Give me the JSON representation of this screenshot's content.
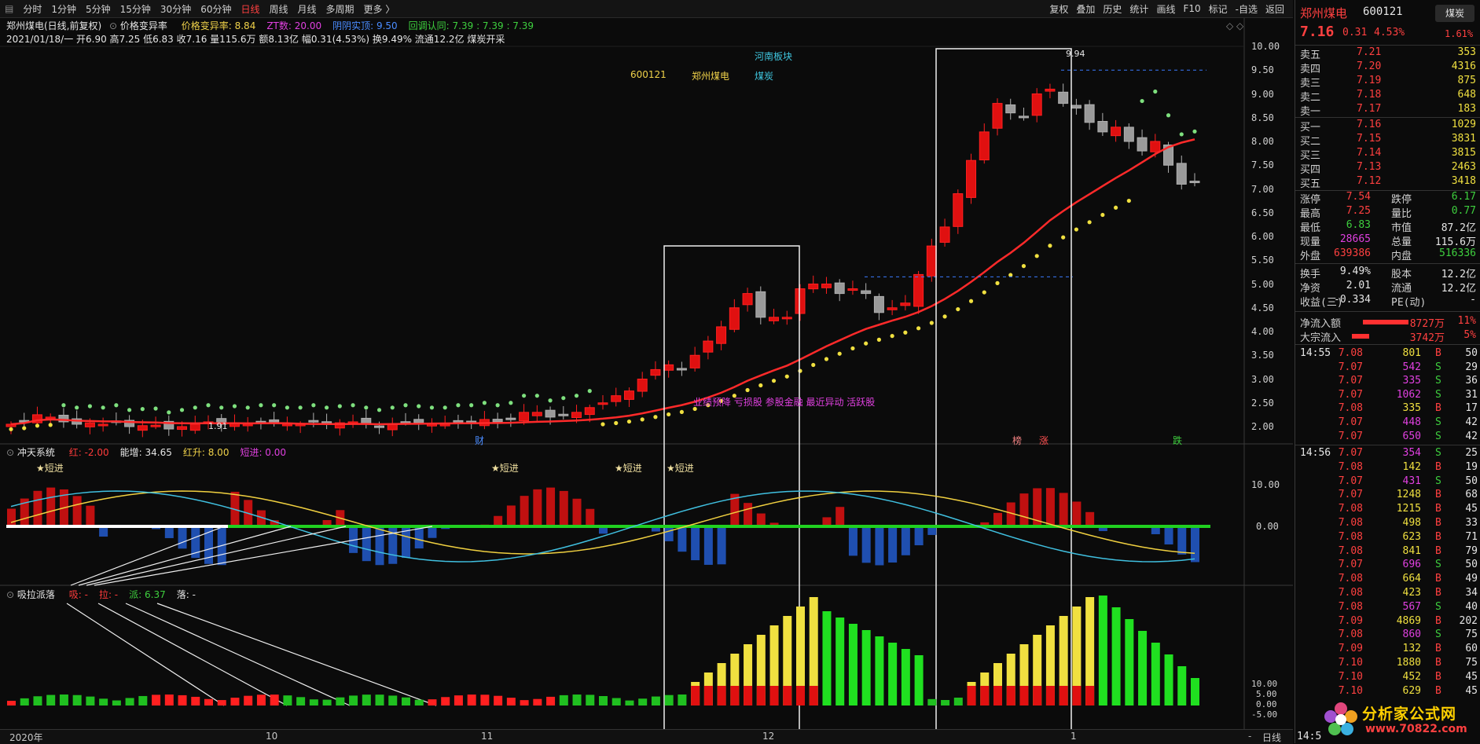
{
  "menu": {
    "periods": [
      "分时",
      "1分钟",
      "5分钟",
      "15分钟",
      "30分钟",
      "60分钟",
      "日线",
      "周线",
      "月线",
      "多周期",
      "更多 〉"
    ],
    "active_period": "日线",
    "right_tools": [
      "复权",
      "叠加",
      "历史",
      "统计",
      "画线",
      "F10",
      "标记",
      "-自选",
      "返回"
    ]
  },
  "header": {
    "title": "郑州煤电(日线,前复权)",
    "indicator": "价格变异率",
    "line1": [
      {
        "t": "价格变异率: 8.84",
        "c": "yel"
      },
      {
        "t": "ZT数: 20.00",
        "c": "mag"
      },
      {
        "t": "阴阴实顶: 9.50",
        "c": "blue"
      },
      {
        "t": "回调认同: 7.39 : 7.39 : 7.39",
        "c": "green"
      }
    ],
    "line2": "2021/01/18/一 开6.90 高7.25 低6.83 收7.16 量115.6万 额8.13亿 幅0.31(4.53%) 换9.49% 流通12.2亿 煤炭开采"
  },
  "overlay": {
    "sector": "河南板块",
    "code": "600121",
    "name": "郑州煤电",
    "industry": "煤炭",
    "tags": "业绩预降  亏损股  参股金融  最近异动  活跃股",
    "high_mark": "9.94",
    "low_mark": "1.91",
    "markers": [
      "财",
      "榜",
      "涨",
      "跌"
    ]
  },
  "price_axis": [
    "10.00",
    "9.50",
    "9.00",
    "8.50",
    "8.00",
    "7.50",
    "7.00",
    "6.50",
    "6.00",
    "5.50",
    "5.00",
    "4.50",
    "4.00",
    "3.50",
    "3.00",
    "2.50",
    "2.00"
  ],
  "panel2": {
    "name": "冲天系统",
    "values": [
      {
        "t": "红: -2.00",
        "c": "red"
      },
      {
        "t": "能增: 34.65",
        "c": "white"
      },
      {
        "t": "红升: 8.00",
        "c": "yel"
      },
      {
        "t": "短进: 0.00",
        "c": "mag"
      }
    ],
    "axis": [
      "10.00",
      "0.00"
    ],
    "signal": "★短进"
  },
  "panel3": {
    "name": "吸拉派落",
    "values": [
      {
        "t": "吸: -",
        "c": "red"
      },
      {
        "t": "拉: -",
        "c": "red"
      },
      {
        "t": "派: 6.37",
        "c": "green"
      },
      {
        "t": "落: -",
        "c": "white"
      }
    ],
    "axis": [
      "10.00",
      "5.00",
      "0.00",
      "-5.00"
    ]
  },
  "xaxis": {
    "labels": [
      "2020年",
      "10",
      "11",
      "12",
      "1"
    ],
    "period": "日线"
  },
  "quote": {
    "name": "郑州煤电",
    "code": "600121",
    "tag": "煤炭",
    "price": "7.16",
    "change": "0.31",
    "pct": "4.53%",
    "right_pct": "1.61%",
    "asks": [
      [
        "卖五",
        "7.21",
        "353"
      ],
      [
        "卖四",
        "7.20",
        "4316"
      ],
      [
        "卖三",
        "7.19",
        "875"
      ],
      [
        "卖二",
        "7.18",
        "648"
      ],
      [
        "卖一",
        "7.17",
        "183"
      ]
    ],
    "bids": [
      [
        "买一",
        "7.16",
        "1029"
      ],
      [
        "买二",
        "7.15",
        "3831"
      ],
      [
        "买三",
        "7.14",
        "3815"
      ],
      [
        "买四",
        "7.13",
        "2463"
      ],
      [
        "买五",
        "7.12",
        "3418"
      ]
    ],
    "stats": [
      [
        "涨停",
        "7.54",
        "跌停",
        "6.17"
      ],
      [
        "最高",
        "7.25",
        "量比",
        "0.77"
      ],
      [
        "最低",
        "6.83",
        "市值",
        "87.2亿"
      ],
      [
        "现量",
        "28665",
        "总量",
        "115.6万"
      ],
      [
        "外盘",
        "639386",
        "内盘",
        "516336"
      ]
    ],
    "stats2": [
      [
        "换手",
        "9.49%",
        "股本",
        "12.2亿"
      ],
      [
        "净资",
        "2.01",
        "流通",
        "12.2亿"
      ],
      [
        "收益(三)",
        "-0.334",
        "PE(动)",
        "-"
      ]
    ],
    "flows": [
      [
        "净流入额",
        "8727万",
        "11%"
      ],
      [
        "大宗流入",
        "3742万",
        "5%"
      ]
    ]
  },
  "ticks1455": [
    [
      "14:55",
      "7.08",
      "801",
      "B",
      "50"
    ],
    [
      "",
      "7.07",
      "542",
      "S",
      "29"
    ],
    [
      "",
      "7.07",
      "335",
      "S",
      "36"
    ],
    [
      "",
      "7.07",
      "1062",
      "S",
      "31"
    ],
    [
      "",
      "7.08",
      "335",
      "B",
      "17"
    ],
    [
      "",
      "7.07",
      "448",
      "S",
      "42"
    ],
    [
      "",
      "7.07",
      "650",
      "S",
      "42"
    ]
  ],
  "ticks1456": [
    [
      "14:56",
      "7.07",
      "354",
      "S",
      "25"
    ],
    [
      "",
      "7.08",
      "142",
      "B",
      "19"
    ],
    [
      "",
      "7.07",
      "431",
      "S",
      "50"
    ],
    [
      "",
      "7.07",
      "1248",
      "B",
      "68"
    ],
    [
      "",
      "7.08",
      "1215",
      "B",
      "45"
    ],
    [
      "",
      "7.08",
      "498",
      "B",
      "33"
    ],
    [
      "",
      "7.08",
      "623",
      "B",
      "71"
    ],
    [
      "",
      "7.08",
      "841",
      "B",
      "79"
    ],
    [
      "",
      "7.07",
      "696",
      "S",
      "50"
    ],
    [
      "",
      "7.08",
      "664",
      "B",
      "49"
    ],
    [
      "",
      "7.08",
      "423",
      "B",
      "34"
    ],
    [
      "",
      "7.08",
      "567",
      "S",
      "40"
    ],
    [
      "",
      "7.09",
      "4869",
      "B",
      "202"
    ],
    [
      "",
      "7.08",
      "860",
      "S",
      "75"
    ],
    [
      "",
      "7.09",
      "132",
      "B",
      "60"
    ],
    [
      "",
      "7.10",
      "1880",
      "B",
      "75"
    ],
    [
      "",
      "7.10",
      "452",
      "B",
      "45"
    ],
    [
      "",
      "7.10",
      "629",
      "B",
      "45"
    ]
  ],
  "bottom_time": "14:5",
  "watermark": {
    "site": "分析家公式网",
    "url": "www.70822.com"
  },
  "chart_data": {
    "type": "candlestick",
    "title": "郑州煤电(日线,前复权)",
    "ylim": [
      1.9,
      10.2
    ],
    "candles_close": [
      2.05,
      2.1,
      2.25,
      2.2,
      2.1,
      2.05,
      2.08,
      2.05,
      2.1,
      2.0,
      2.02,
      2.03,
      1.95,
      2.0,
      2.05,
      2.1,
      2.05,
      2.08,
      2.05,
      2.1,
      2.1,
      2.05,
      2.05,
      2.1,
      2.05,
      2.08,
      2.1,
      2.05,
      2.0,
      2.05,
      2.1,
      2.08,
      2.05,
      2.05,
      2.1,
      2.1,
      2.15,
      2.1,
      2.15,
      2.3,
      2.3,
      2.2,
      2.25,
      2.3,
      2.4,
      2.5,
      2.65,
      2.75,
      3.0,
      3.2,
      3.3,
      3.2,
      3.5,
      3.8,
      4.1,
      4.5,
      4.8,
      4.3,
      4.3,
      4.3,
      4.9,
      5.0,
      5.0,
      4.8,
      4.9,
      4.8,
      4.4,
      4.5,
      4.6,
      5.2,
      5.8,
      6.2,
      6.9,
      7.6,
      8.2,
      8.8,
      8.6,
      8.5,
      9.0,
      9.1,
      8.8,
      8.7,
      8.4,
      8.2,
      8.3,
      8.0,
      7.8,
      8.0,
      7.5,
      7.1,
      7.16
    ]
  }
}
